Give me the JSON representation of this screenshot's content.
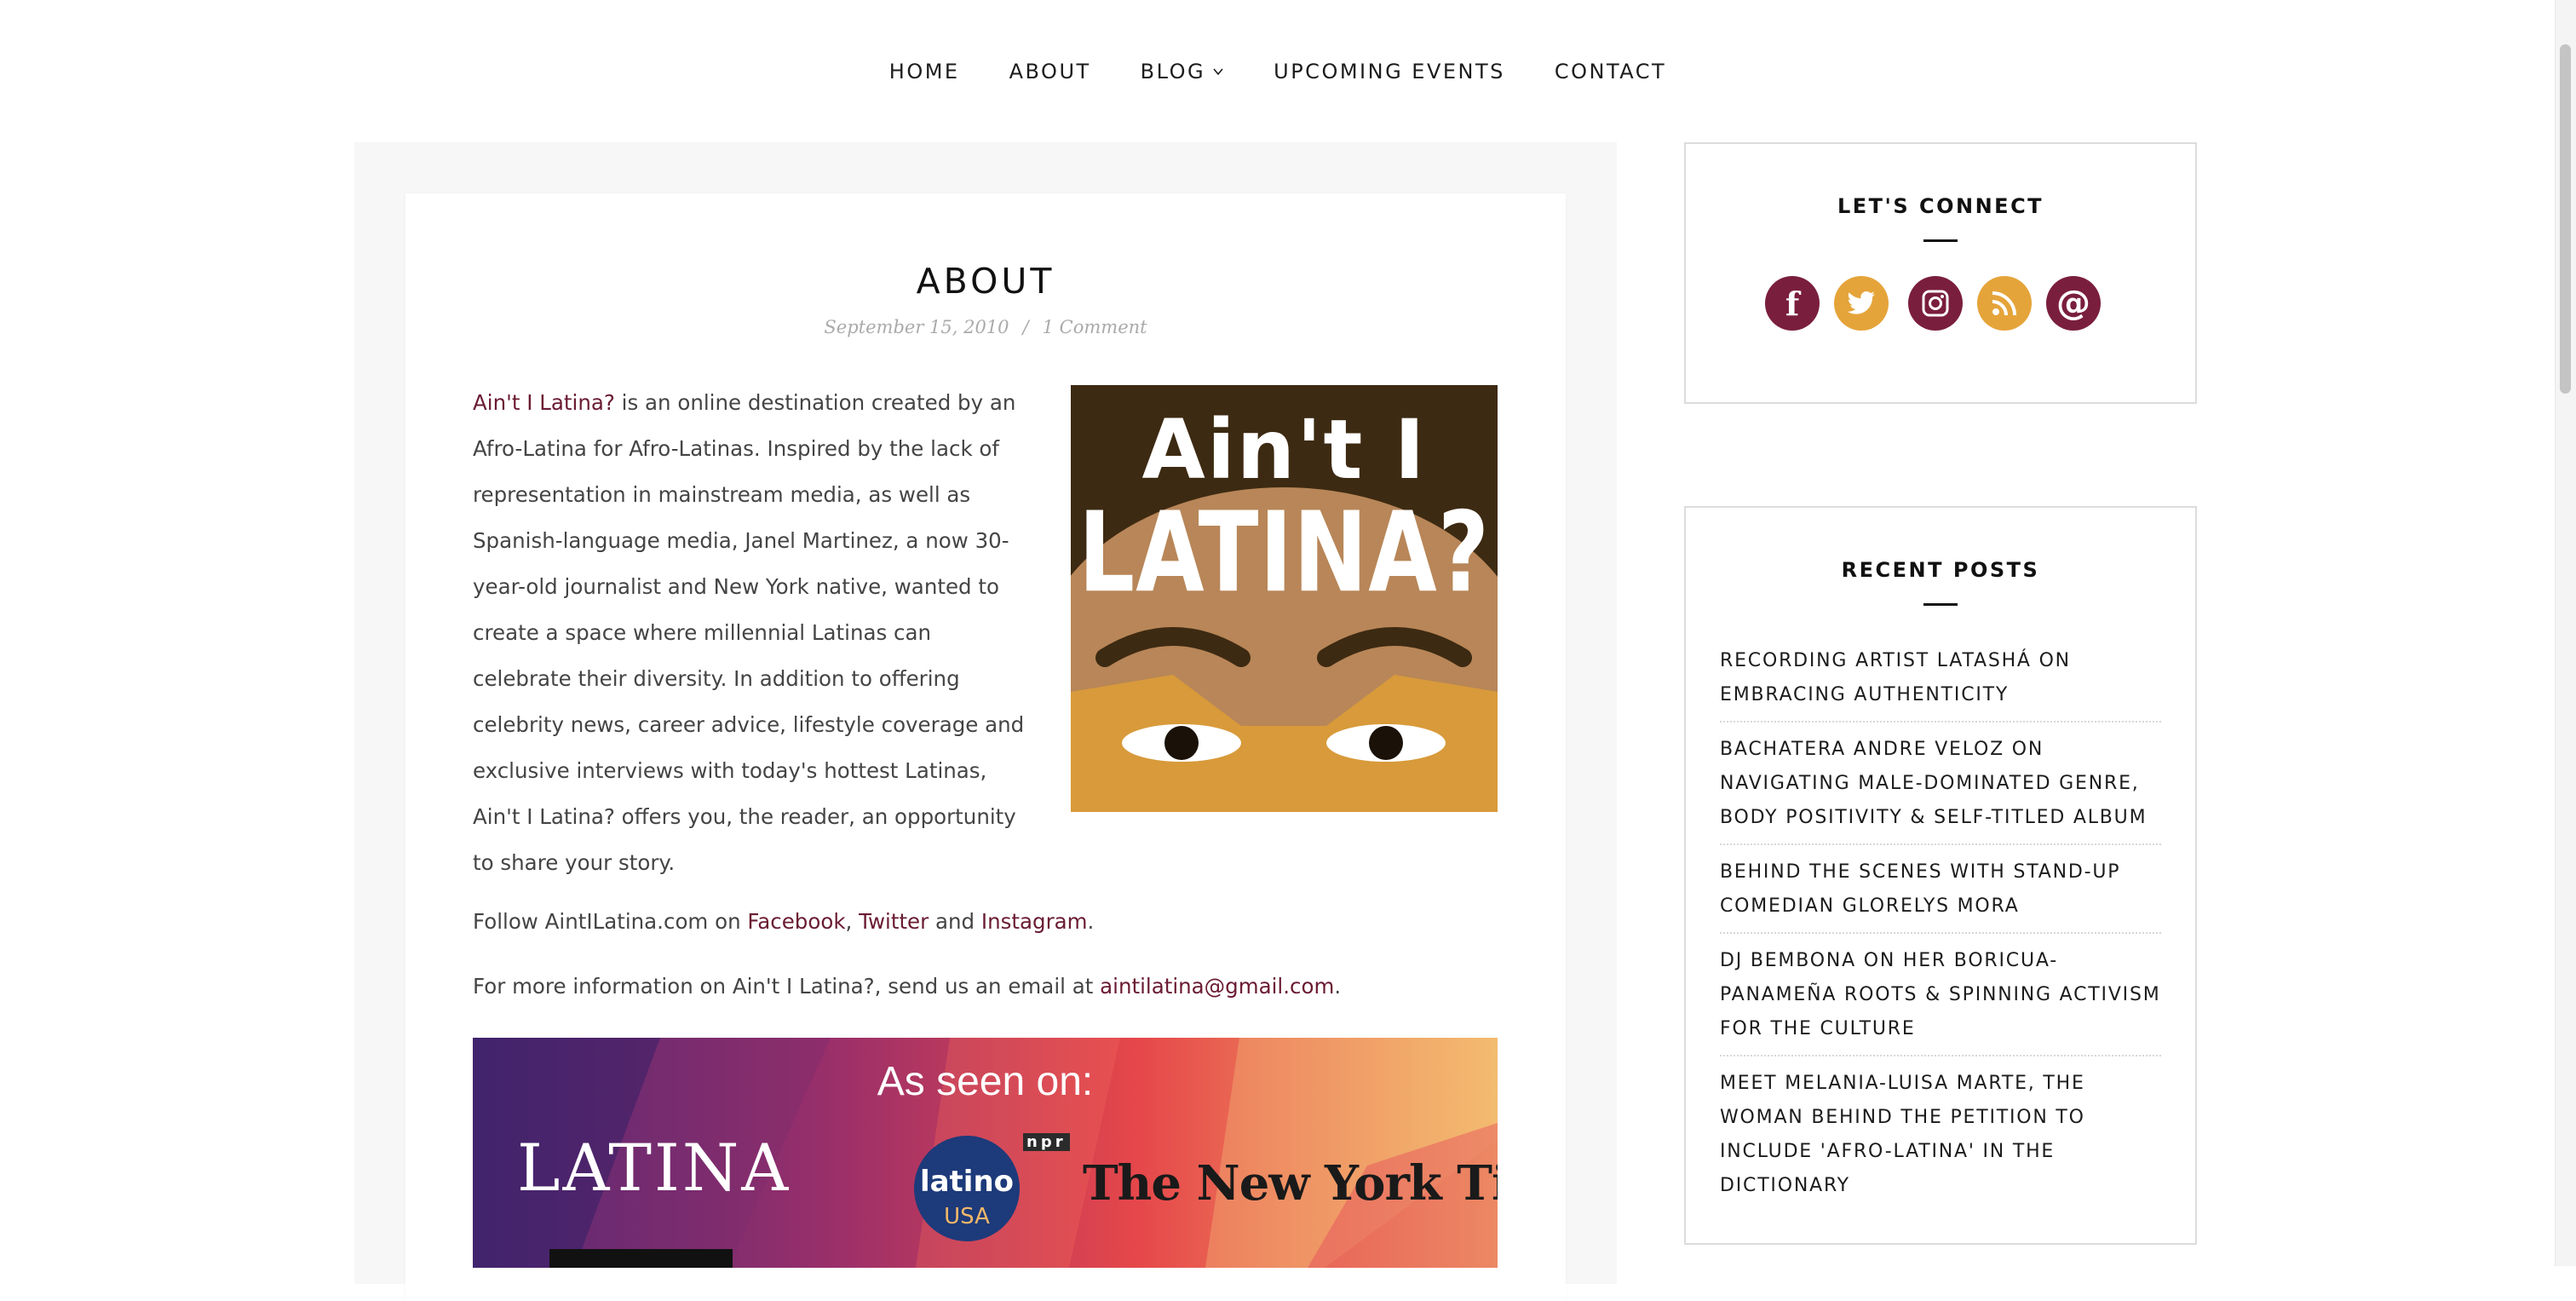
{
  "nav": {
    "items": [
      {
        "label": "HOME"
      },
      {
        "label": "ABOUT"
      },
      {
        "label": "BLOG"
      },
      {
        "label": "UPCOMING EVENTS"
      },
      {
        "label": "CONTACT"
      }
    ]
  },
  "post": {
    "title": "ABOUT",
    "date": "September 15, 2010",
    "separator": "/",
    "comments": "1 Comment",
    "intro_link": "Ain't I Latina?",
    "intro_text": " is an online destination created by an Afro-Latina for Afro-Latinas. Inspired by the lack of representation in mainstream media, as well as Spanish-language media, Janel Martinez, a now 30-year-old journalist and New York native, wanted to create a space where millennial Latinas can celebrate their diversity. In addition to offering celebrity news, career advice, lifestyle coverage and exclusive interviews with today's hottest Latinas, Ain't I Latina? offers you, the reader, an opportunity to share your story.",
    "follow_prefix": "Follow AintILatina.com on ",
    "facebook": "Facebook",
    "comma": ", ",
    "twitter": "Twitter",
    "and": " and ",
    "instagram": "Instagram",
    "period": ".",
    "email_prefix": "For more information on Ain't I Latina?, send us an email at ",
    "email": "aintilatina@gmail.com",
    "cover": {
      "line1": "Ain't I",
      "line2": "LATINA?"
    },
    "banner": {
      "heading": "As seen on:",
      "latina": "LATINA",
      "npr": "npr",
      "latino": "latino",
      "usa": "USA",
      "nyt": "The New York Times"
    }
  },
  "sidebar": {
    "connect_title": "LET'S CONNECT",
    "social": [
      {
        "icon": "facebook-icon",
        "glyph": "f",
        "color": "#7a1e3d"
      },
      {
        "icon": "twitter-icon",
        "glyph": "t",
        "color": "#e5a43a"
      },
      {
        "icon": "instagram-icon",
        "glyph": "",
        "color": "#7a1e3d"
      },
      {
        "icon": "rss-icon",
        "glyph": "",
        "color": "#e5a43a"
      },
      {
        "icon": "email-icon",
        "glyph": "@",
        "color": "#7a1e3d"
      }
    ],
    "recent_title": "RECENT POSTS",
    "recent": [
      "RECORDING ARTIST LATASHÁ ON EMBRACING AUTHENTICITY",
      "BACHATERA ANDRE VELOZ ON NAVIGATING MALE-DOMINATED GENRE, BODY POSITIVITY & SELF-TITLED ALBUM",
      "BEHIND THE SCENES WITH STAND-UP COMEDIAN GLORELYS MORA",
      "DJ BEMBONA ON HER BORICUA-PANAMEÑA ROOTS & SPINNING ACTIVISM FOR THE CULTURE",
      "MEET MELANIA-LUISA MARTE, THE WOMAN BEHIND THE PETITION TO INCLUDE 'AFRO-LATINA' IN THE DICTIONARY"
    ]
  },
  "colors": {
    "link": "#6a1b32",
    "accent": "#e5a43a",
    "brand": "#7a1e3d"
  }
}
